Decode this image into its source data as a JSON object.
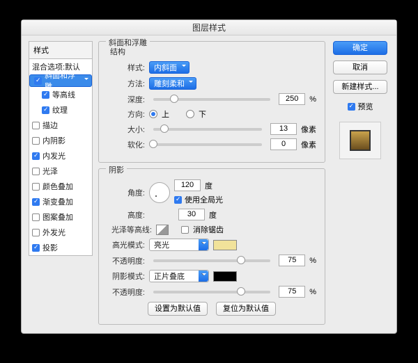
{
  "title": "图层样式",
  "sidebar": {
    "header": "样式",
    "default": "混合选项:默认",
    "items": [
      {
        "label": "斜面和浮雕",
        "on": true,
        "sel": true
      },
      {
        "label": "等高线",
        "on": true,
        "sub": true
      },
      {
        "label": "纹理",
        "on": true,
        "sub": true
      },
      {
        "label": "描边",
        "on": false
      },
      {
        "label": "内阴影",
        "on": false
      },
      {
        "label": "内发光",
        "on": true
      },
      {
        "label": "光泽",
        "on": false
      },
      {
        "label": "颜色叠加",
        "on": false
      },
      {
        "label": "渐变叠加",
        "on": true
      },
      {
        "label": "图案叠加",
        "on": false
      },
      {
        "label": "外发光",
        "on": false
      },
      {
        "label": "投影",
        "on": true
      }
    ]
  },
  "struct": {
    "group": "斜面和浮雕",
    "subhdr": "结构",
    "style_l": "样式:",
    "style_v": "内斜面",
    "method_l": "方法:",
    "method_v": "雕刻柔和",
    "depth_l": "深度:",
    "depth_v": "250",
    "pct": "%",
    "dir_l": "方向:",
    "up": "上",
    "down": "下",
    "size_l": "大小:",
    "size_v": "13",
    "px": "像素",
    "soft_l": "软化:",
    "soft_v": "0"
  },
  "shadow": {
    "group": "阴影",
    "angle_l": "角度:",
    "angle_v": "120",
    "deg": "度",
    "global": "使用全局光",
    "alt_l": "高度:",
    "alt_v": "30",
    "contour_l": "光泽等高线:",
    "aa": "消除锯齿",
    "hi_l": "高光模式:",
    "hi_v": "亮光",
    "hi_op": "75",
    "sh_l": "阴影模式:",
    "sh_v": "正片叠底",
    "sh_op": "75",
    "op_l": "不透明度:"
  },
  "buttons": {
    "ok": "确定",
    "cancel": "取消",
    "new": "新建样式...",
    "preview": "预览",
    "def": "设置为默认值",
    "reset": "复位为默认值"
  }
}
